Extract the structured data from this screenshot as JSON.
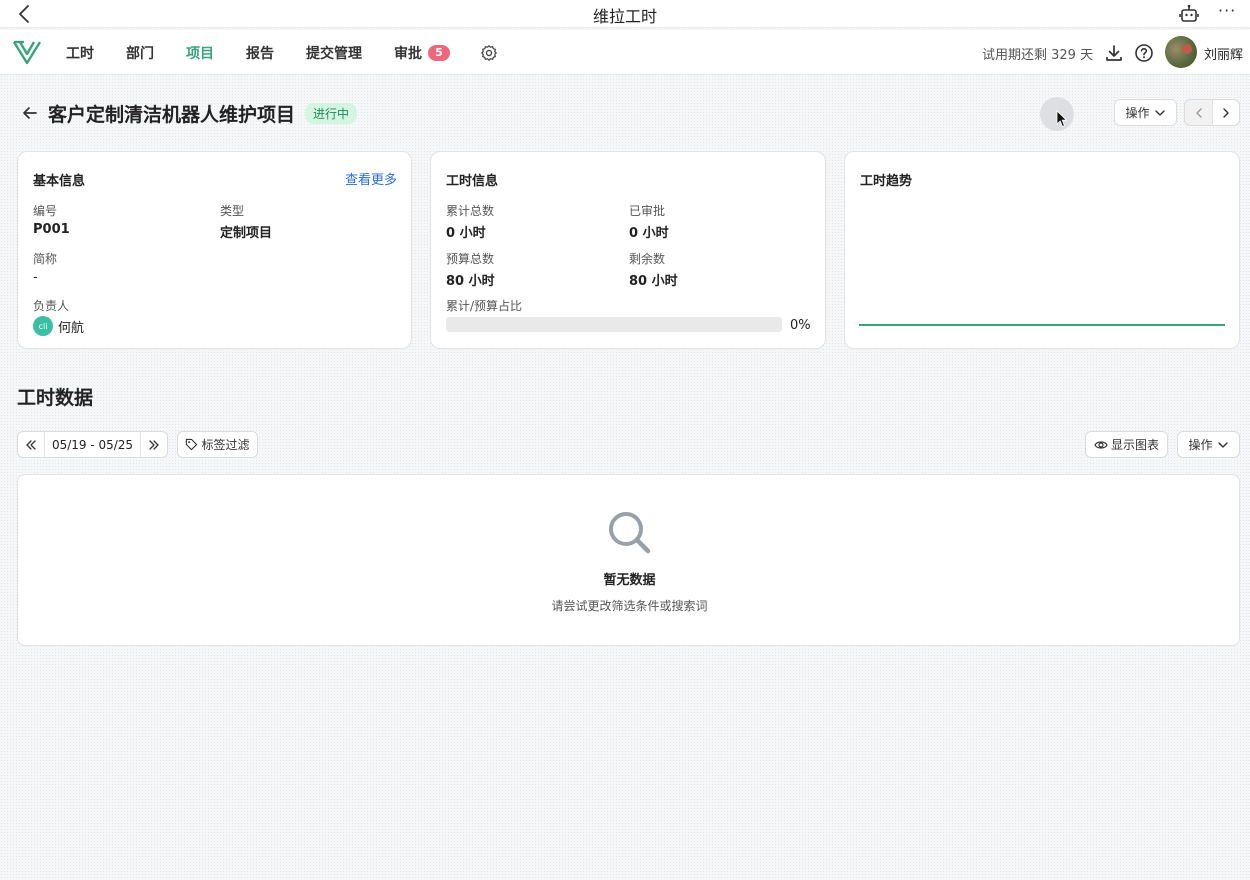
{
  "window": {
    "title": "维拉工时"
  },
  "nav": {
    "items": [
      {
        "label": "工时"
      },
      {
        "label": "部门"
      },
      {
        "label": "项目"
      },
      {
        "label": "报告"
      },
      {
        "label": "提交管理"
      },
      {
        "label": "审批"
      }
    ],
    "active_index": 2,
    "approval_badge": "5",
    "trial_text": "试用期还剩 329 天",
    "user_name": "刘丽辉",
    "accent_color": "#3aa37b",
    "badge_color": "#f0667a"
  },
  "project": {
    "title": "客户定制清洁机器人维护项目",
    "status": "进行中",
    "ops_label": "操作"
  },
  "basic_info": {
    "title": "基本信息",
    "more_link": "查看更多",
    "code_label": "编号",
    "code_value": "P001",
    "type_label": "类型",
    "type_value": "定制项目",
    "short_label": "简称",
    "short_value": "-",
    "owner_label": "负责人",
    "owner_name": "何航",
    "owner_avatar_text": "cli"
  },
  "hours_info": {
    "title": "工时信息",
    "total_label": "累计总数",
    "total_value": "0 小时",
    "approved_label": "已审批",
    "approved_value": "0 小时",
    "budget_label": "预算总数",
    "budget_value": "80 小时",
    "remain_label": "剩余数",
    "remain_value": "80 小时",
    "ratio_label": "累计/预算占比",
    "ratio_text": "0%",
    "ratio_value": 0
  },
  "trend": {
    "title": "工时趋势"
  },
  "section": {
    "title": "工时数据",
    "date_range": "05/19 - 05/25",
    "tag_filter": "标签过滤",
    "show_chart": "显示图表",
    "ops_label": "操作"
  },
  "empty": {
    "title": "暂无数据",
    "desc": "请尝试更改筛选条件或搜索词"
  }
}
